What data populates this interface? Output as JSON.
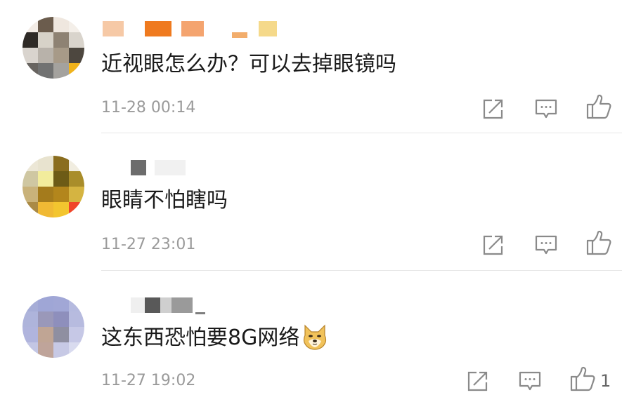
{
  "comments": [
    {
      "text": "近视眼怎么办？可以去掉眼镜吗",
      "time": "11-28 00:14",
      "like_count": ""
    },
    {
      "text": "眼睛不怕瞎吗",
      "time": "11-27 23:01",
      "like_count": ""
    },
    {
      "text": "这东西恐怕要8G网络",
      "time": "11-27 19:02",
      "like_count": "1",
      "emoji": "doge-emoji"
    }
  ],
  "icons": {
    "share": "share-icon",
    "comment": "comment-icon",
    "like": "thumbs-up-icon"
  },
  "colors": {
    "text": "#1a1a1a",
    "time": "#9a9a9a",
    "icon": "#8a8a8a",
    "divider": "#e6e6e6"
  }
}
